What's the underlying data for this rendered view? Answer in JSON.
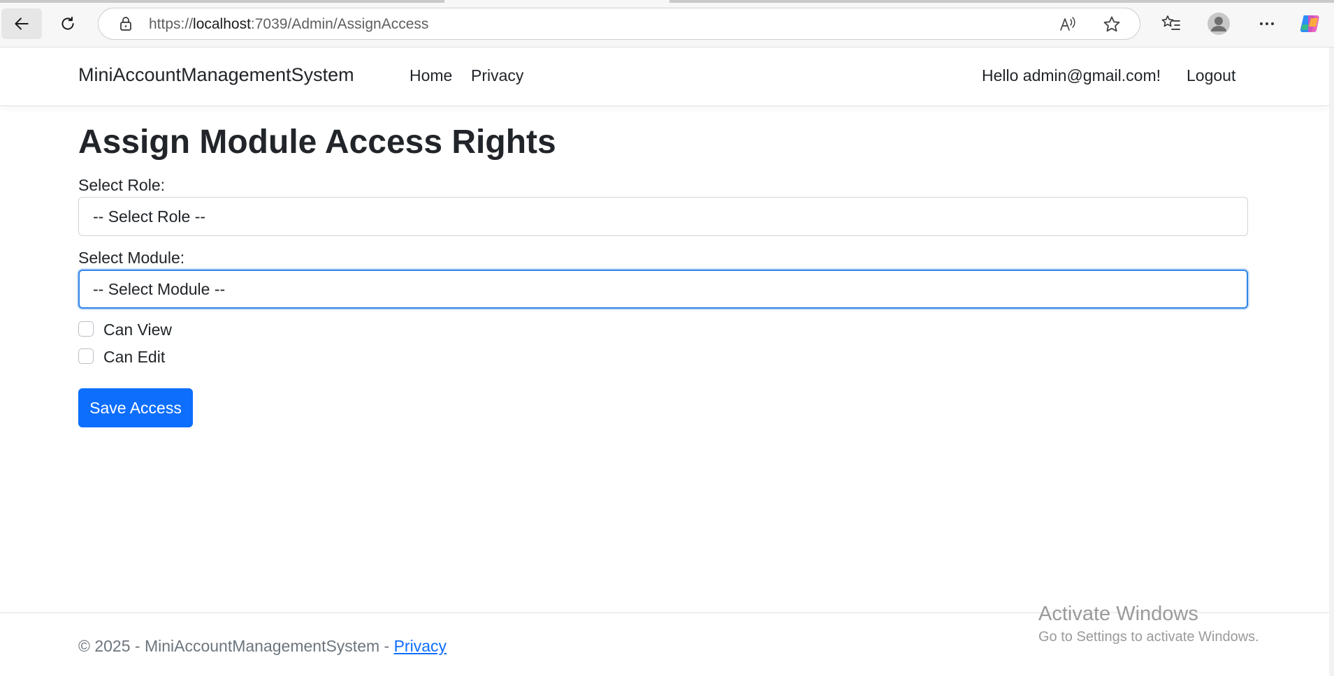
{
  "browser": {
    "url_prefix": "https://",
    "url_host": "localhost",
    "url_rest": ":7039/Admin/AssignAccess"
  },
  "navbar": {
    "brand": "MiniAccountManagementSystem",
    "links": [
      "Home",
      "Privacy"
    ],
    "greeting": "Hello admin@gmail.com!",
    "logout": "Logout"
  },
  "main": {
    "title": "Assign Module Access Rights",
    "role_label": "Select Role:",
    "role_selected": "-- Select Role --",
    "module_label": "Select Module:",
    "module_selected": "-- Select Module --",
    "can_view_label": "Can View",
    "can_edit_label": "Can Edit",
    "save_button": "Save Access"
  },
  "footer": {
    "copyright": "© 2025 - MiniAccountManagementSystem - ",
    "privacy_link": "Privacy"
  },
  "watermark": {
    "title": "Activate Windows",
    "subtitle": "Go to Settings to activate Windows."
  },
  "colors": {
    "primary": "#0d6efd",
    "focus_border": "#2f84e8",
    "text": "#212529",
    "muted": "#6c757d"
  }
}
